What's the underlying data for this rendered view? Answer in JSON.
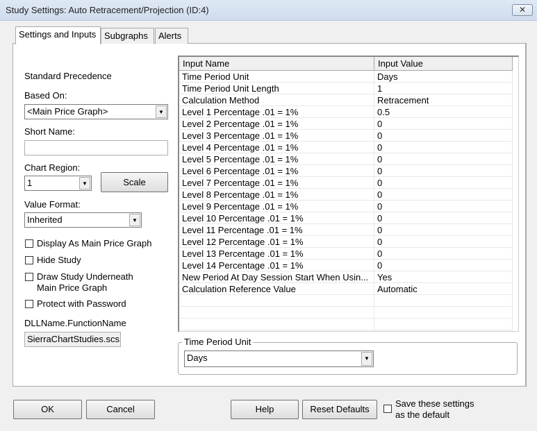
{
  "window": {
    "title": "Study Settings: Auto Retracement/Projection (ID:4)",
    "close": "✕"
  },
  "tabs": [
    "Settings and Inputs",
    "Subgraphs",
    "Alerts"
  ],
  "left": {
    "standard_precedence": "Standard Precedence",
    "based_on_label": "Based On:",
    "based_on_value": "<Main Price Graph>",
    "short_name_label": "Short Name:",
    "short_name_value": "",
    "chart_region_label": "Chart Region:",
    "chart_region_value": "1",
    "scale_button": "Scale",
    "value_format_label": "Value Format:",
    "value_format_value": "Inherited",
    "checkboxes": [
      "Display As Main Price Graph",
      "Hide Study",
      "Draw Study Underneath",
      "Main Price Graph",
      "Protect with Password"
    ],
    "dll_label": "DLLName.FunctionName",
    "dll_value": "SierraChartStudies.scs"
  },
  "grid": {
    "headers": [
      "Input Name",
      "Input Value"
    ],
    "rows": [
      [
        "Time Period Unit",
        "Days"
      ],
      [
        "Time Period Unit Length",
        "1"
      ],
      [
        "Calculation Method",
        "Retracement"
      ],
      [
        "Level 1 Percentage .01 = 1%",
        "0.5"
      ],
      [
        "Level 2 Percentage .01 = 1%",
        "0"
      ],
      [
        "Level 3 Percentage .01 = 1%",
        "0"
      ],
      [
        "Level 4 Percentage .01 = 1%",
        "0"
      ],
      [
        "Level 5 Percentage .01 = 1%",
        "0"
      ],
      [
        "Level 6 Percentage .01 = 1%",
        "0"
      ],
      [
        "Level 7 Percentage .01 = 1%",
        "0"
      ],
      [
        "Level 8 Percentage .01 = 1%",
        "0"
      ],
      [
        "Level 9 Percentage .01 = 1%",
        "0"
      ],
      [
        "Level 10 Percentage .01 = 1%",
        "0"
      ],
      [
        "Level 11 Percentage .01 = 1%",
        "0"
      ],
      [
        "Level 12 Percentage .01 = 1%",
        "0"
      ],
      [
        "Level 13 Percentage .01 = 1%",
        "0"
      ],
      [
        "Level 14 Percentage .01 = 1%",
        "0"
      ],
      [
        "New Period At Day Session Start When Usin...",
        "Yes"
      ],
      [
        "Calculation Reference Value",
        "Automatic"
      ],
      [
        "",
        ""
      ],
      [
        "",
        ""
      ],
      [
        "",
        ""
      ]
    ]
  },
  "editor": {
    "label": "Time Period Unit",
    "value": "Days"
  },
  "buttons": {
    "ok": "OK",
    "cancel": "Cancel",
    "help": "Help",
    "reset": "Reset Defaults",
    "save_default_1": "Save these settings",
    "save_default_2": "as the default"
  }
}
